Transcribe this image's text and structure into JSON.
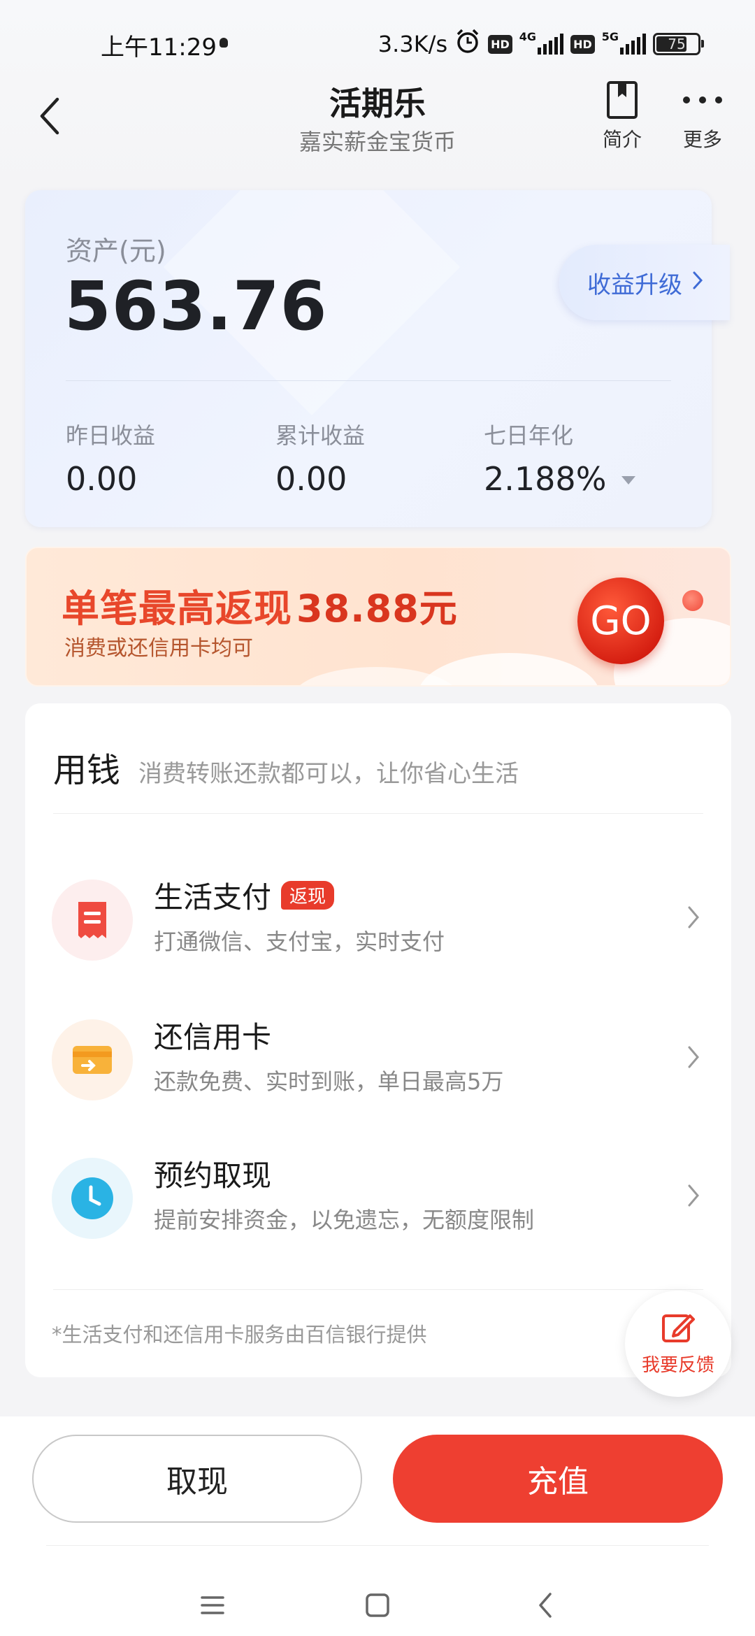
{
  "status_bar": {
    "time": "上午11:29",
    "network_speed": "3.3K/s",
    "battery": "75",
    "battery_level": 0.75,
    "signal_1": "4G",
    "signal_2": "5G",
    "hd_badge": "HD"
  },
  "header": {
    "title": "活期乐",
    "subtitle": "嘉实薪金宝货币",
    "intro_label": "简介",
    "more_label": "更多"
  },
  "asset": {
    "label": "资产(元)",
    "value": "563.76",
    "upgrade_label": "收益升级",
    "stats": [
      {
        "label": "昨日收益",
        "value": "0.00"
      },
      {
        "label": "累计收益",
        "value": "0.00"
      },
      {
        "label": "七日年化",
        "value": "2.188%"
      }
    ]
  },
  "promo": {
    "title": "单笔最高返现38.88元",
    "subtitle": "消费或还信用卡均可",
    "go_label": "GO"
  },
  "use_money": {
    "title": "用钱",
    "description": "消费转账还款都可以，让你省心生活",
    "items": [
      {
        "name": "生活支付",
        "tag": "返现",
        "desc": "打通微信、支付宝，实时支付"
      },
      {
        "name": "还信用卡",
        "desc": "还款免费、实时到账，单日最高5万"
      },
      {
        "name": "预约取现",
        "desc": "提前安排资金，以免遗忘，无额度限制"
      }
    ],
    "footnote": "*生活支付和还信用卡服务由百信银行提供"
  },
  "feedback": {
    "label": "我要反馈"
  },
  "actions": {
    "withdraw": "取现",
    "recharge": "充值"
  },
  "colors": {
    "accent_red": "#ee3f31",
    "accent_blue": "#3f6bd6"
  }
}
